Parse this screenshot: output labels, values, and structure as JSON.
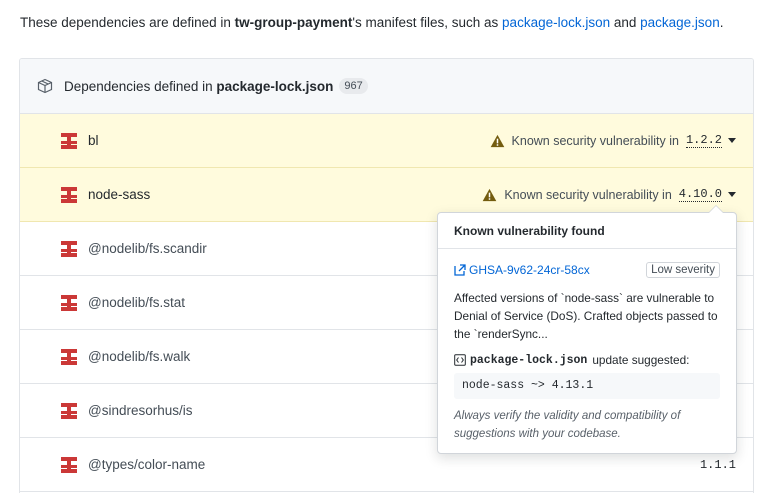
{
  "intro": {
    "prefix": "These dependencies are defined in ",
    "repo": "tw-group-payment",
    "middle": "'s manifest files, such as ",
    "link1": "package-lock.json",
    "and": " and ",
    "link2": "package.json",
    "suffix": "."
  },
  "header": {
    "prefix": "Dependencies defined in ",
    "file": "package-lock.json",
    "count": "967"
  },
  "vuln_text": "Known security vulnerability in",
  "rows": [
    {
      "name": "bl",
      "version": "1.2.2"
    },
    {
      "name": "node-sass",
      "version": "4.10.0"
    },
    {
      "name": "@nodelib/fs.scandir"
    },
    {
      "name": "@nodelib/fs.stat"
    },
    {
      "name": "@nodelib/fs.walk"
    },
    {
      "name": "@sindresorhus/is"
    },
    {
      "name": "@types/color-name",
      "version": "1.1.1"
    }
  ],
  "popover": {
    "title": "Known vulnerability found",
    "advisory": "GHSA-9v62-24cr-58cx",
    "severity": "Low severity",
    "desc1": "Affected versions of `node-sass` are vulnerable to",
    "desc2": "Denial of Service (DoS). Crafted objects passed to",
    "desc3": "the `renderSync...",
    "suggest_file": "package-lock.json",
    "suggest_text": "update suggested:",
    "code": "node-sass ~> 4.13.1",
    "note1": "Always verify the validity and compatibility of",
    "note2": "suggestions with your codebase."
  },
  "colors": {
    "link": "#0366d6",
    "vuln_bg": "#fffbdd",
    "dep_icon": "#cb3837",
    "warn": "#735c0f"
  }
}
